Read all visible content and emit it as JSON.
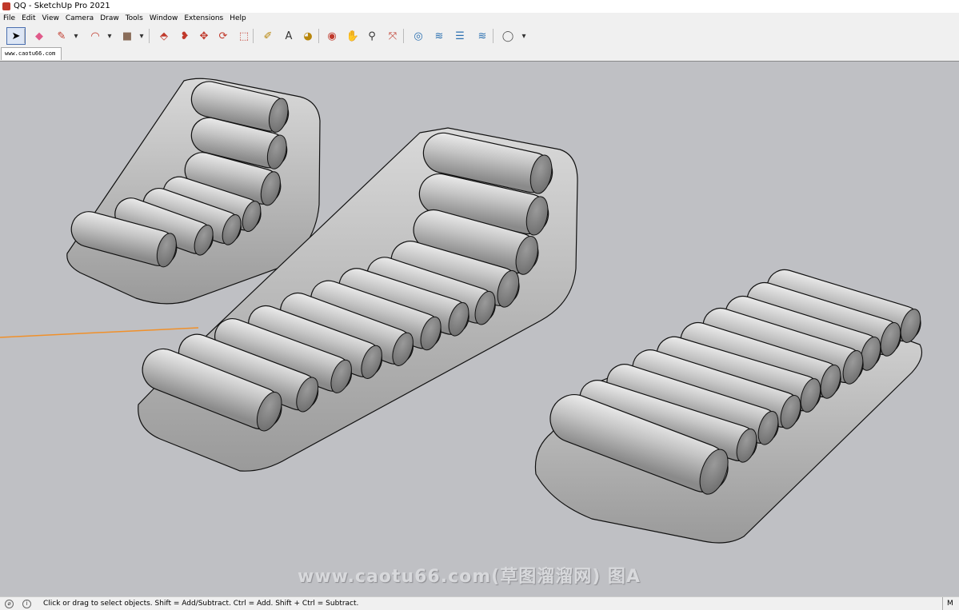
{
  "window": {
    "title": "QQ - SketchUp Pro 2021"
  },
  "menu": [
    "File",
    "Edit",
    "View",
    "Camera",
    "Draw",
    "Tools",
    "Window",
    "Extensions",
    "Help"
  ],
  "toolbar": {
    "tools": [
      {
        "name": "select-tool",
        "glyph": "➤",
        "color": "#000000",
        "selected": true
      },
      {
        "name": "eraser-tool",
        "glyph": "◆",
        "color": "#e05a8a"
      },
      {
        "name": "pencil-tool",
        "glyph": "✎",
        "color": "#c0392b"
      },
      {
        "name": "pencil-dropdown",
        "glyph": "▾",
        "color": "#333333"
      },
      {
        "name": "arc-tool",
        "glyph": "◠",
        "color": "#c0392b"
      },
      {
        "name": "arc-dropdown",
        "glyph": "▾",
        "color": "#333333"
      },
      {
        "name": "rectangle-tool",
        "glyph": "■",
        "color": "#8a6d5a"
      },
      {
        "name": "rectangle-dropdown",
        "glyph": "▾",
        "color": "#333333"
      },
      {
        "name": "push-pull-tool",
        "glyph": "⬘",
        "color": "#c0392b"
      },
      {
        "name": "follow-me-tool",
        "glyph": "❥",
        "color": "#c0392b"
      },
      {
        "name": "move-tool",
        "glyph": "✥",
        "color": "#c0392b"
      },
      {
        "name": "rotate-tool",
        "glyph": "⟳",
        "color": "#c0392b"
      },
      {
        "name": "scale-tool",
        "glyph": "⬚",
        "color": "#c0392b"
      },
      {
        "name": "tape-measure-tool",
        "glyph": "✐",
        "color": "#b8860b"
      },
      {
        "name": "text-tool",
        "glyph": "A",
        "color": "#333333"
      },
      {
        "name": "paint-bucket-tool",
        "glyph": "◕",
        "color": "#b8860b"
      },
      {
        "name": "orbit-tool",
        "glyph": "◉",
        "color": "#c0392b"
      },
      {
        "name": "pan-tool",
        "glyph": "✋",
        "color": "#b8860b"
      },
      {
        "name": "zoom-tool",
        "glyph": "⚲",
        "color": "#333333"
      },
      {
        "name": "zoom-extents-tool",
        "glyph": "⤧",
        "color": "#c0392b"
      },
      {
        "name": "3d-warehouse-tool",
        "glyph": "◎",
        "color": "#2a6fb0"
      },
      {
        "name": "extension-warehouse-tool",
        "glyph": "≋",
        "color": "#2a6fb0"
      },
      {
        "name": "layout-send-tool",
        "glyph": "☰",
        "color": "#2a6fb0"
      },
      {
        "name": "extension-manager-tool",
        "glyph": "≋",
        "color": "#2a6fb0"
      },
      {
        "name": "account-tool",
        "glyph": "◯",
        "color": "#555555"
      },
      {
        "name": "account-dropdown",
        "glyph": "▾",
        "color": "#333333"
      }
    ]
  },
  "tab": {
    "label": "www.caotu66.com"
  },
  "watermark": "www.caotu66.com(草图溜溜网) 图A",
  "status": {
    "message": "Click or drag to select objects. Shift = Add/Subtract. Ctrl = Add. Shift + Ctrl = Subtract.",
    "right": "M"
  }
}
